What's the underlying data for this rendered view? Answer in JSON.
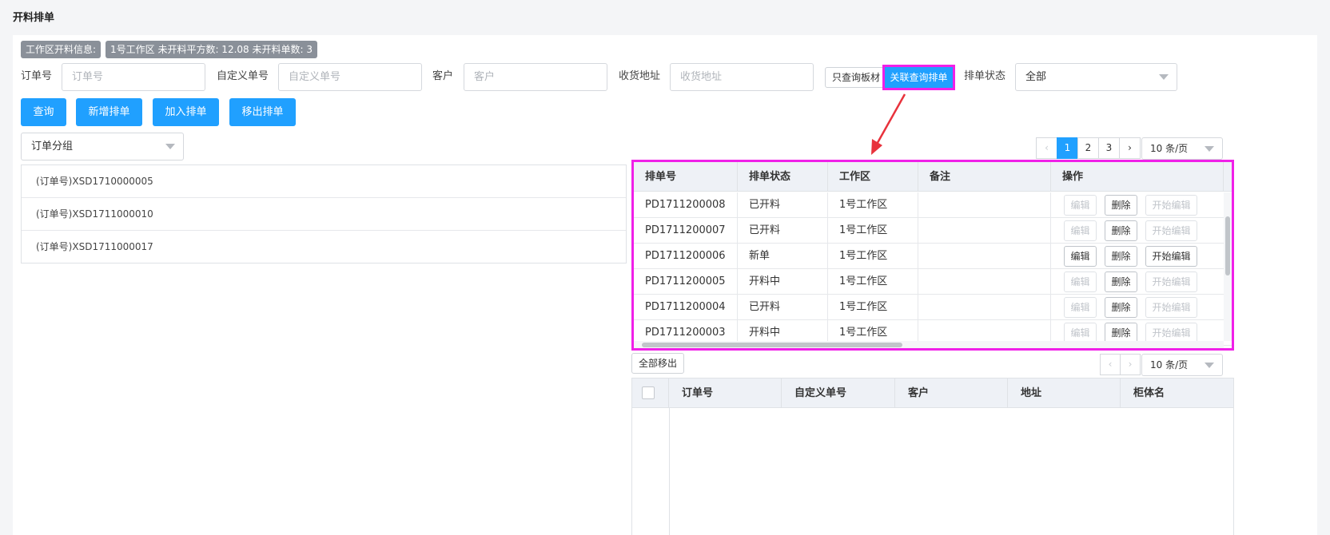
{
  "page_title": "开料排单",
  "info": {
    "label": "工作区开料信息:",
    "summary": "1号工作区 未开料平方数: 12.08 未开料单数: 3"
  },
  "filters": {
    "order_no": {
      "label": "订单号",
      "placeholder": "订单号"
    },
    "custom_no": {
      "label": "自定义单号",
      "placeholder": "自定义单号"
    },
    "customer": {
      "label": "客户",
      "placeholder": "客户"
    },
    "address": {
      "label": "收货地址",
      "placeholder": "收货地址"
    },
    "query_board_only": "只查询板材",
    "linked_query": "关联查询排单",
    "status": {
      "label": "排单状态",
      "value": "全部"
    }
  },
  "actions": {
    "query": "查询",
    "add_schedule": "新增排单",
    "join_schedule": "加入排单",
    "remove_schedule": "移出排单"
  },
  "group_select": "订单分组",
  "orders": [
    "(订单号)XSD1710000005",
    "(订单号)XSD1711000010",
    "(订单号)XSD1711000017"
  ],
  "pager1": {
    "pages": [
      "1",
      "2",
      "3"
    ],
    "page_size": "10 条/页",
    "prev": "‹",
    "next": "›"
  },
  "schedule_table": {
    "headers": [
      "排单号",
      "排单状态",
      "工作区",
      "备注",
      "操作"
    ],
    "btn_edit": "编辑",
    "btn_delete": "删除",
    "btn_start_edit": "开始编辑",
    "rows": [
      {
        "no": "PD1711200008",
        "status": "已开料",
        "area": "1号工作区",
        "note": ""
      },
      {
        "no": "PD1711200007",
        "status": "已开料",
        "area": "1号工作区",
        "note": ""
      },
      {
        "no": "PD1711200006",
        "status": "新单",
        "area": "1号工作区",
        "note": ""
      },
      {
        "no": "PD1711200005",
        "status": "开料中",
        "area": "1号工作区",
        "note": ""
      },
      {
        "no": "PD1711200004",
        "status": "已开料",
        "area": "1号工作区",
        "note": ""
      },
      {
        "no": "PD1711200003",
        "status": "开料中",
        "area": "1号工作区",
        "note": ""
      }
    ]
  },
  "remove_all": "全部移出",
  "pager2": {
    "page_size": "10 条/页",
    "prev": "‹",
    "next": "›"
  },
  "detail_table": {
    "headers": [
      "订单号",
      "自定义单号",
      "客户",
      "地址",
      "柜体名"
    ]
  },
  "colors": {
    "primary": "#20a0ff",
    "highlight": "#f020e8",
    "arrow": "#e8323c"
  }
}
